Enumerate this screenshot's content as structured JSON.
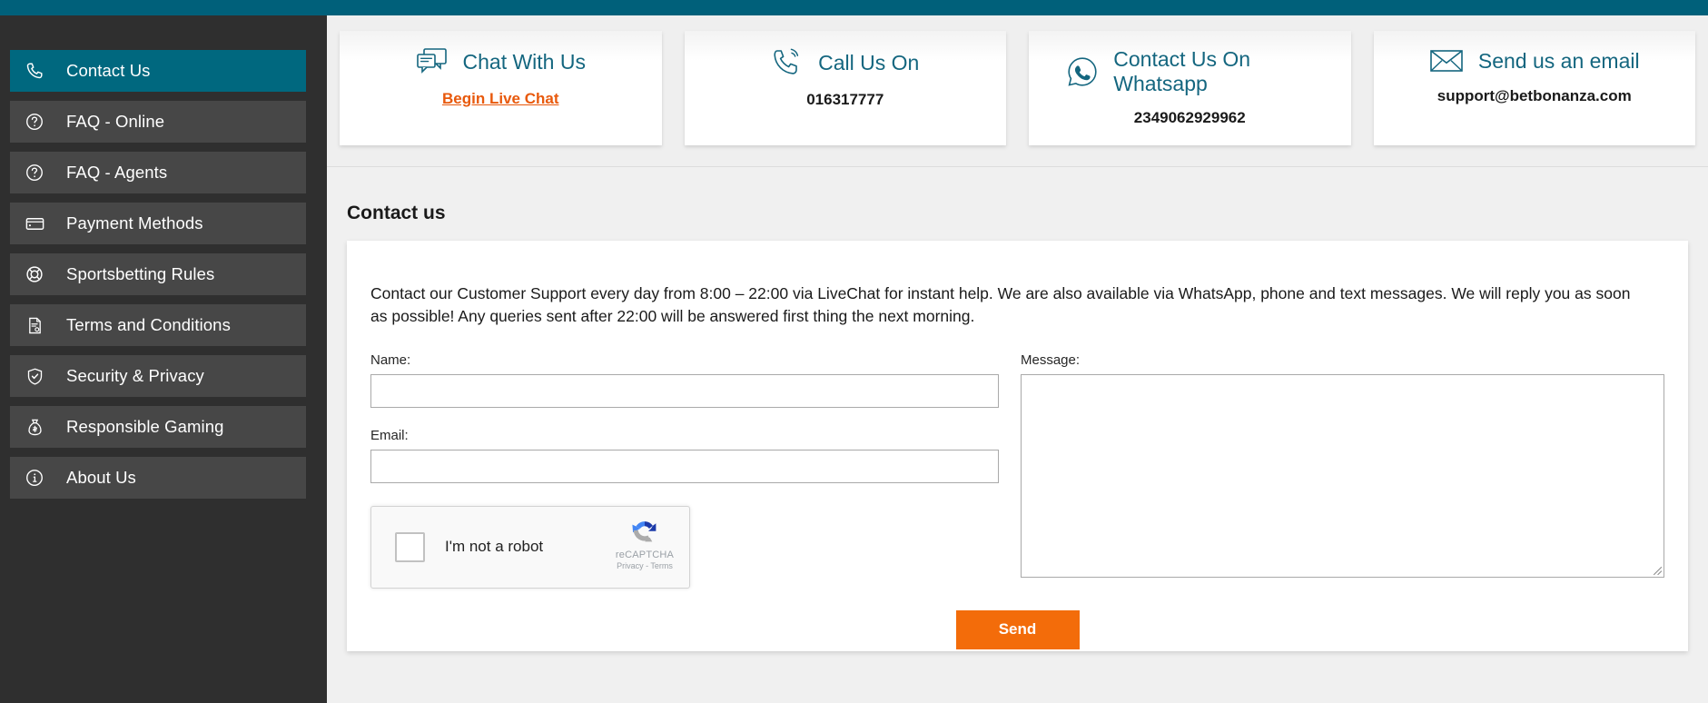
{
  "topbar": {
    "color": "#00607a"
  },
  "sidebar": {
    "items": [
      {
        "label": "Contact Us",
        "icon": "phone-icon",
        "active": true
      },
      {
        "label": "FAQ - Online",
        "icon": "question-circle-icon",
        "active": false
      },
      {
        "label": "FAQ - Agents",
        "icon": "question-circle-icon",
        "active": false
      },
      {
        "label": "Payment Methods",
        "icon": "credit-card-icon",
        "active": false
      },
      {
        "label": "Sportsbetting Rules",
        "icon": "lifebuoy-icon",
        "active": false
      },
      {
        "label": "Terms and Conditions",
        "icon": "document-icon",
        "active": false
      },
      {
        "label": "Security & Privacy",
        "icon": "shield-check-icon",
        "active": false
      },
      {
        "label": "Responsible Gaming",
        "icon": "money-bag-icon",
        "active": false
      },
      {
        "label": "About Us",
        "icon": "info-circle-icon",
        "active": false
      }
    ]
  },
  "cards": [
    {
      "title": "Chat With Us",
      "icon": "chat-bubbles-icon",
      "link": "Begin Live Chat",
      "value": ""
    },
    {
      "title": "Call Us On",
      "icon": "phone-ring-icon",
      "link": "",
      "value": "016317777"
    },
    {
      "title": "Contact Us On Whatsapp",
      "icon": "whatsapp-icon",
      "link": "",
      "value": "2349062929962"
    },
    {
      "title": "Send us an email",
      "icon": "envelope-icon",
      "link": "",
      "value": "support@betbonanza.com"
    }
  ],
  "section": {
    "title": "Contact us",
    "intro": "Contact our Customer Support every day from 8:00 – 22:00 via LiveChat for instant help. We are also available via WhatsApp, phone and text messages. We will reply you as soon as possible! Any queries sent after 22:00 will be answered first thing the next morning."
  },
  "form": {
    "name_label": "Name:",
    "name_value": "",
    "name_placeholder": "",
    "email_label": "Email:",
    "email_value": "",
    "email_placeholder": "",
    "message_label": "Message:",
    "message_value": "",
    "message_placeholder": "",
    "send_label": "Send",
    "send_color": "#f36c0a"
  },
  "recaptcha": {
    "checkbox_label": "I'm not a robot",
    "brand": "reCAPTCHA",
    "legal": "Privacy - Terms",
    "checked": false
  }
}
